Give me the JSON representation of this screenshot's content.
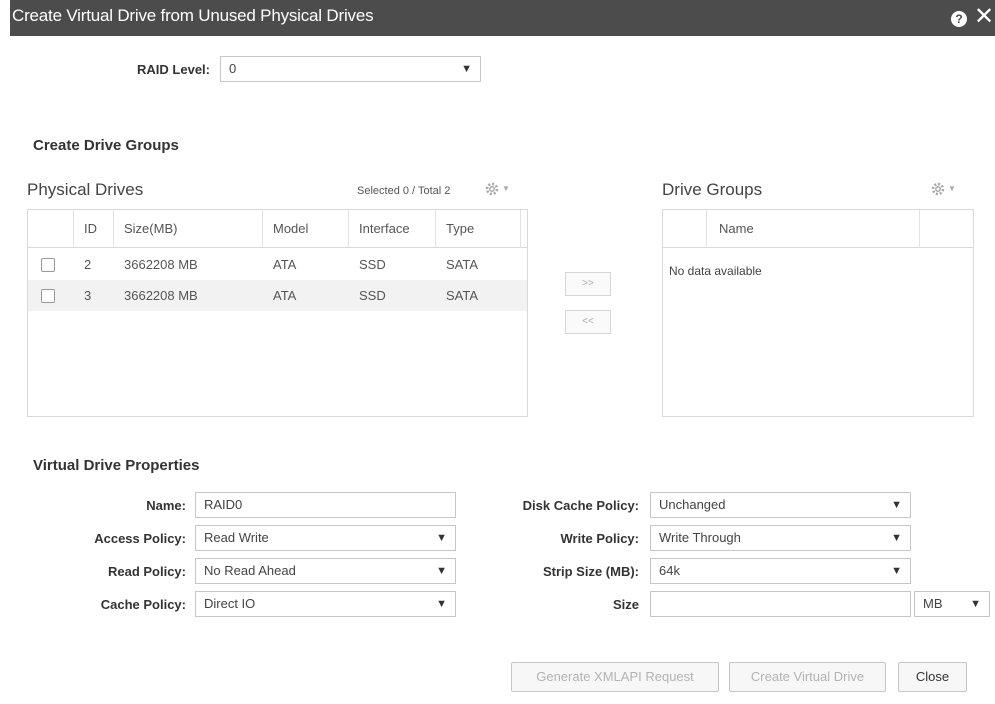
{
  "dialog": {
    "title": "Create Virtual Drive from Unused Physical Drives",
    "help_glyph": "?",
    "close_glyph": "✕"
  },
  "raid": {
    "label": "RAID Level:",
    "value": "0"
  },
  "drive_groups_section": {
    "title": "Create Drive Groups"
  },
  "physical_drives": {
    "title": "Physical Drives",
    "selection_text": "Selected 0 / Total 2",
    "columns": [
      "ID",
      "Size(MB)",
      "Model",
      "Interface",
      "Type"
    ],
    "rows": [
      {
        "id": "2",
        "size": "3662208 MB",
        "model": "ATA",
        "interface": "SSD",
        "type": "SATA"
      },
      {
        "id": "3",
        "size": "3662208 MB",
        "model": "ATA",
        "interface": "SSD",
        "type": "SATA"
      }
    ]
  },
  "move_buttons": {
    "add": ">>",
    "remove": "<<"
  },
  "drive_groups": {
    "title": "Drive Groups",
    "columns": [
      "Name"
    ],
    "empty_text": "No data available"
  },
  "vd_properties": {
    "title": "Virtual Drive Properties",
    "name_label": "Name:",
    "name_value": "RAID0",
    "access_label": "Access Policy:",
    "access_value": "Read Write",
    "read_label": "Read Policy:",
    "read_value": "No Read Ahead",
    "cache_label": "Cache Policy:",
    "cache_value": "Direct IO",
    "disk_cache_label": "Disk Cache Policy:",
    "disk_cache_value": "Unchanged",
    "write_label": "Write Policy:",
    "write_value": "Write Through",
    "strip_label": "Strip Size (MB):",
    "strip_value": "64k",
    "size_label": "Size",
    "size_value": "",
    "size_unit": "MB"
  },
  "footer": {
    "generate_label": "Generate XMLAPI Request",
    "create_label": "Create Virtual Drive",
    "close_label": "Close"
  },
  "icons": {
    "gear": "gear-icon",
    "dropdown": "chevron-down-icon"
  },
  "colors": {
    "titlebar": "#4c4c4c",
    "border": "#d9d9d9",
    "row_alt": "#f2f2f2"
  }
}
